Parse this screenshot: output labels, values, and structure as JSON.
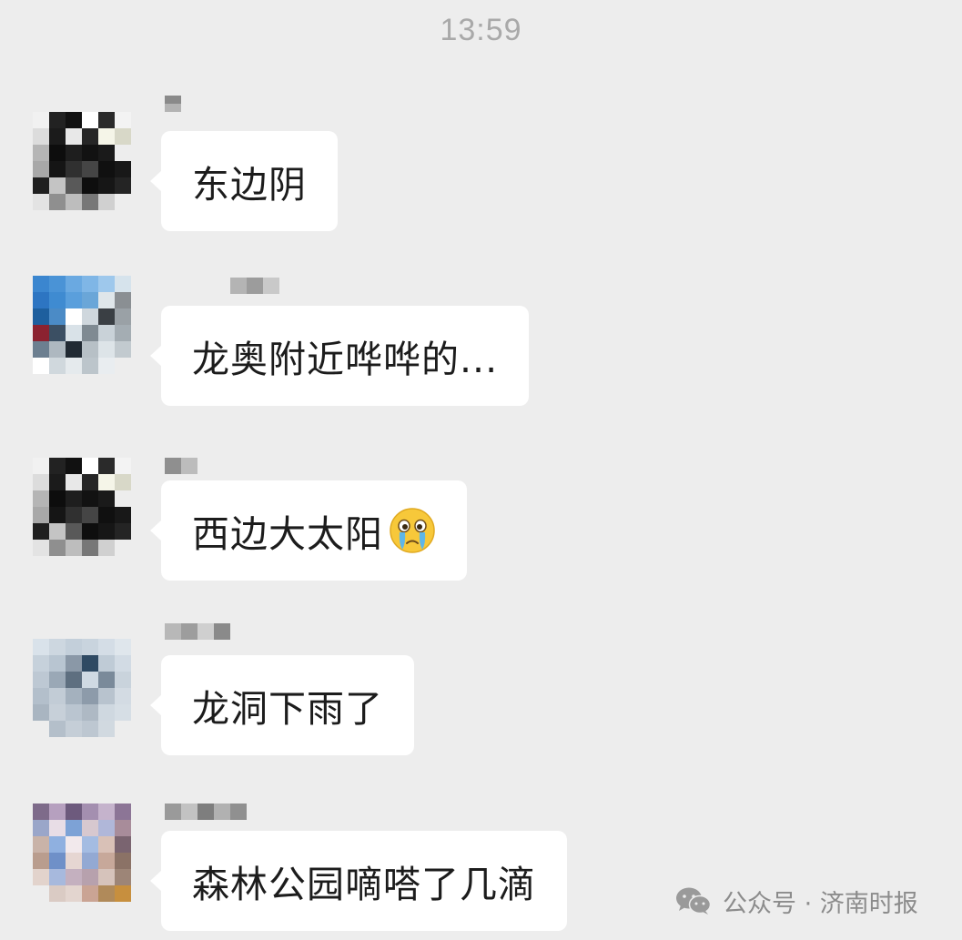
{
  "header": {
    "time": "13:59"
  },
  "messages": [
    {
      "text": "东边阴",
      "avatar": [
        "#f1f1f1",
        "#222222",
        "#111111",
        "#ffffff",
        "#2a2a2a",
        "#f3f3f3",
        "#dcdcdc",
        "#1b1b1b",
        "#e8e8e8",
        "#262626",
        "#f5f5e8",
        "#d8d8c8",
        "#b5b5b5",
        "#0d0d0d",
        "#1e1e1e",
        "#121212",
        "#1a1a1a",
        "#ededed",
        "#a8a8a8",
        "#151515",
        "#303030",
        "#454545",
        "#101010",
        "#181818",
        "#1f1f1f",
        "#c4c4c4",
        "#595959",
        "#0e0e0e",
        "#161616",
        "#242424",
        "#e3e3e3",
        "#8f8f8f",
        "#bdbdbd",
        "#777777",
        "#d0d0d0",
        "#ededed"
      ],
      "nick": [
        "#8a8a8a",
        "#b3b3b3"
      ]
    },
    {
      "text": "龙奥附近哗哗的...",
      "avatar": [
        "#3b86cf",
        "#4a93d6",
        "#6aa9e1",
        "#7fb6e6",
        "#9ec8ec",
        "#d6e3ec",
        "#2d75c2",
        "#3f8bd1",
        "#5a9fdc",
        "#6aa6d8",
        "#dfe6ea",
        "#8a8f93",
        "#1e5f9e",
        "#4b8bc6",
        "#ffffff",
        "#cfd7dd",
        "#3a3f44",
        "#9aa1a6",
        "#8b2230",
        "#3b4f63",
        "#d9e2e8",
        "#7f8a92",
        "#c9d2d8",
        "#a4adb3",
        "#6c7f90",
        "#aeb8c0",
        "#212a33",
        "#b7c0c6",
        "#dde4e8",
        "#c2cacf",
        "#ffffff",
        "#d0d8dd",
        "#e5eaed",
        "#bcc5cb",
        "#e9edf0",
        "#ededed"
      ],
      "nick": [
        "#b4b4b4",
        "#9c9c9c",
        "#c9c9c9"
      ]
    },
    {
      "text": "西边大太阳",
      "avatar": [
        "#f1f1f1",
        "#222222",
        "#111111",
        "#ffffff",
        "#2a2a2a",
        "#f3f3f3",
        "#dcdcdc",
        "#1b1b1b",
        "#e8e8e8",
        "#262626",
        "#f5f5e8",
        "#d8d8c8",
        "#b5b5b5",
        "#0d0d0d",
        "#1e1e1e",
        "#121212",
        "#1a1a1a",
        "#ededed",
        "#a8a8a8",
        "#151515",
        "#303030",
        "#454545",
        "#101010",
        "#181818",
        "#1f1f1f",
        "#c4c4c4",
        "#595959",
        "#0e0e0e",
        "#161616",
        "#242424",
        "#e3e3e3",
        "#8f8f8f",
        "#bdbdbd",
        "#777777",
        "#d0d0d0",
        "#ededed"
      ],
      "nick": [
        "#8f8f8f",
        "#bcbcbc"
      ]
    },
    {
      "text": "龙洞下雨了",
      "avatar": [
        "#d9e2ea",
        "#cdd7e0",
        "#c3cfda",
        "#c9d4de",
        "#d4dde6",
        "#dfe6ec",
        "#c6d1db",
        "#b8c5d1",
        "#8a98a7",
        "#2f4a63",
        "#bfcbd6",
        "#d2dbe4",
        "#bdc8d3",
        "#9aa8b6",
        "#5e6f80",
        "#d0dae3",
        "#7a8a9a",
        "#c9d3dc",
        "#b3bfcb",
        "#c2ccd6",
        "#a4b1be",
        "#8d9baa",
        "#b8c3ce",
        "#d3dbe3",
        "#a9b5c1",
        "#c7d0d9",
        "#bac5d0",
        "#aeb9c4",
        "#cfd8e0",
        "#d6dee5",
        "#ededed",
        "#b4bfca",
        "#c5ced7",
        "#bdc7d1",
        "#d1d9e0",
        "#ededed"
      ],
      "nick": [
        "#b8b8b8",
        "#9d9d9d",
        "#cfcfcf",
        "#8a8a8a"
      ]
    },
    {
      "text": "森林公园嘀嗒了几滴",
      "avatar": [
        "#7e6b8a",
        "#b6a0bf",
        "#6d5a7d",
        "#a48fb0",
        "#c5b3cc",
        "#8c7596",
        "#9aa6c9",
        "#e8dde6",
        "#7da2d6",
        "#d7c8cf",
        "#b0b7d9",
        "#a88c9a",
        "#c9b3a8",
        "#8fb0e0",
        "#f2e9ec",
        "#a4bce2",
        "#d9c1b7",
        "#7a6470",
        "#b99d8e",
        "#6f90c8",
        "#e6d6d2",
        "#93a9d3",
        "#c7a89a",
        "#8b7266",
        "#e2d3cc",
        "#a7b9dd",
        "#c4b0bf",
        "#b7a1ad",
        "#d6c3bb",
        "#9d8577",
        "#ededed",
        "#dacbc4",
        "#e3d5cf",
        "#caa494",
        "#b08a5a",
        "#c78f3e"
      ],
      "nick": [
        "#9a9a9a",
        "#c2c2c2",
        "#7e7e7e",
        "#b1b1b1",
        "#909090"
      ]
    }
  ],
  "emoji": {
    "icon": "crying-face-icon",
    "skin": "#f7c83a",
    "tears": "#5fb6e8"
  },
  "watermark": {
    "label": "公众号 · 济南时报",
    "icon": "wechat-icon"
  }
}
